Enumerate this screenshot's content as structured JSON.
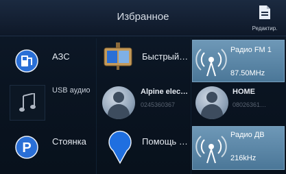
{
  "header": {
    "title": "Избранное",
    "edit_label": "Редактир."
  },
  "favorites": [
    {
      "label": "АЗС",
      "icon": "gas-station-icon"
    },
    {
      "label": "Быстрый…",
      "icon": "speed-dial-icon"
    },
    {
      "label": "Радио FM 1",
      "value": "87.50MHz",
      "icon": "radio-fm-icon"
    },
    {
      "label": "USB аудио",
      "icon": "music-note-icon"
    },
    {
      "label": "Alpine elec…",
      "sub": "0245360367",
      "icon": "contact-avatar-icon"
    },
    {
      "label": "HOME",
      "sub": "08026361…",
      "icon": "contact-avatar-icon"
    },
    {
      "label": "Стоянка",
      "icon": "parking-icon"
    },
    {
      "label": "Помощь …",
      "icon": "map-pin-icon"
    },
    {
      "label": "Радио ДВ",
      "value": "216kHz",
      "icon": "radio-lw-icon"
    }
  ],
  "colors": {
    "accent": "#2a6fd6",
    "tile": "#6e98b7"
  }
}
